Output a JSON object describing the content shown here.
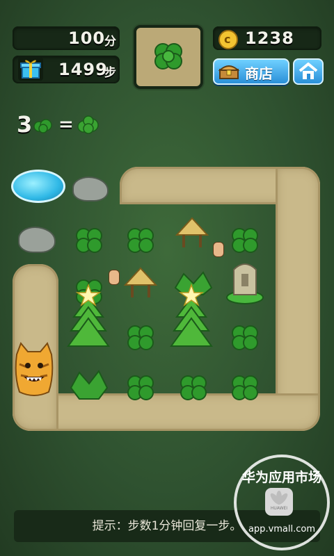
{
  "hud": {
    "score_value": "100",
    "score_unit": "分",
    "steps_value": "1499",
    "steps_unit": "步",
    "coins_value": "1238",
    "shop_label": "商店"
  },
  "rule": {
    "count": "3",
    "equals": "="
  },
  "hint": {
    "text": "提示：步数1分钟回复一步。"
  },
  "watermark": {
    "title": "华为应用市场",
    "url": "app.vmall.com",
    "logo_text": "HUAWEI"
  },
  "icons": {
    "gift": "gift-icon",
    "coin": "coin-icon",
    "shop": "treasure-chest-icon",
    "home": "home-icon",
    "next_piece": "clover-icon"
  },
  "colors": {
    "background": "#2f5230",
    "panel": "#172817",
    "path": "#c9b98a",
    "button": "#2a8fd8",
    "text": "#f2f2ea"
  }
}
